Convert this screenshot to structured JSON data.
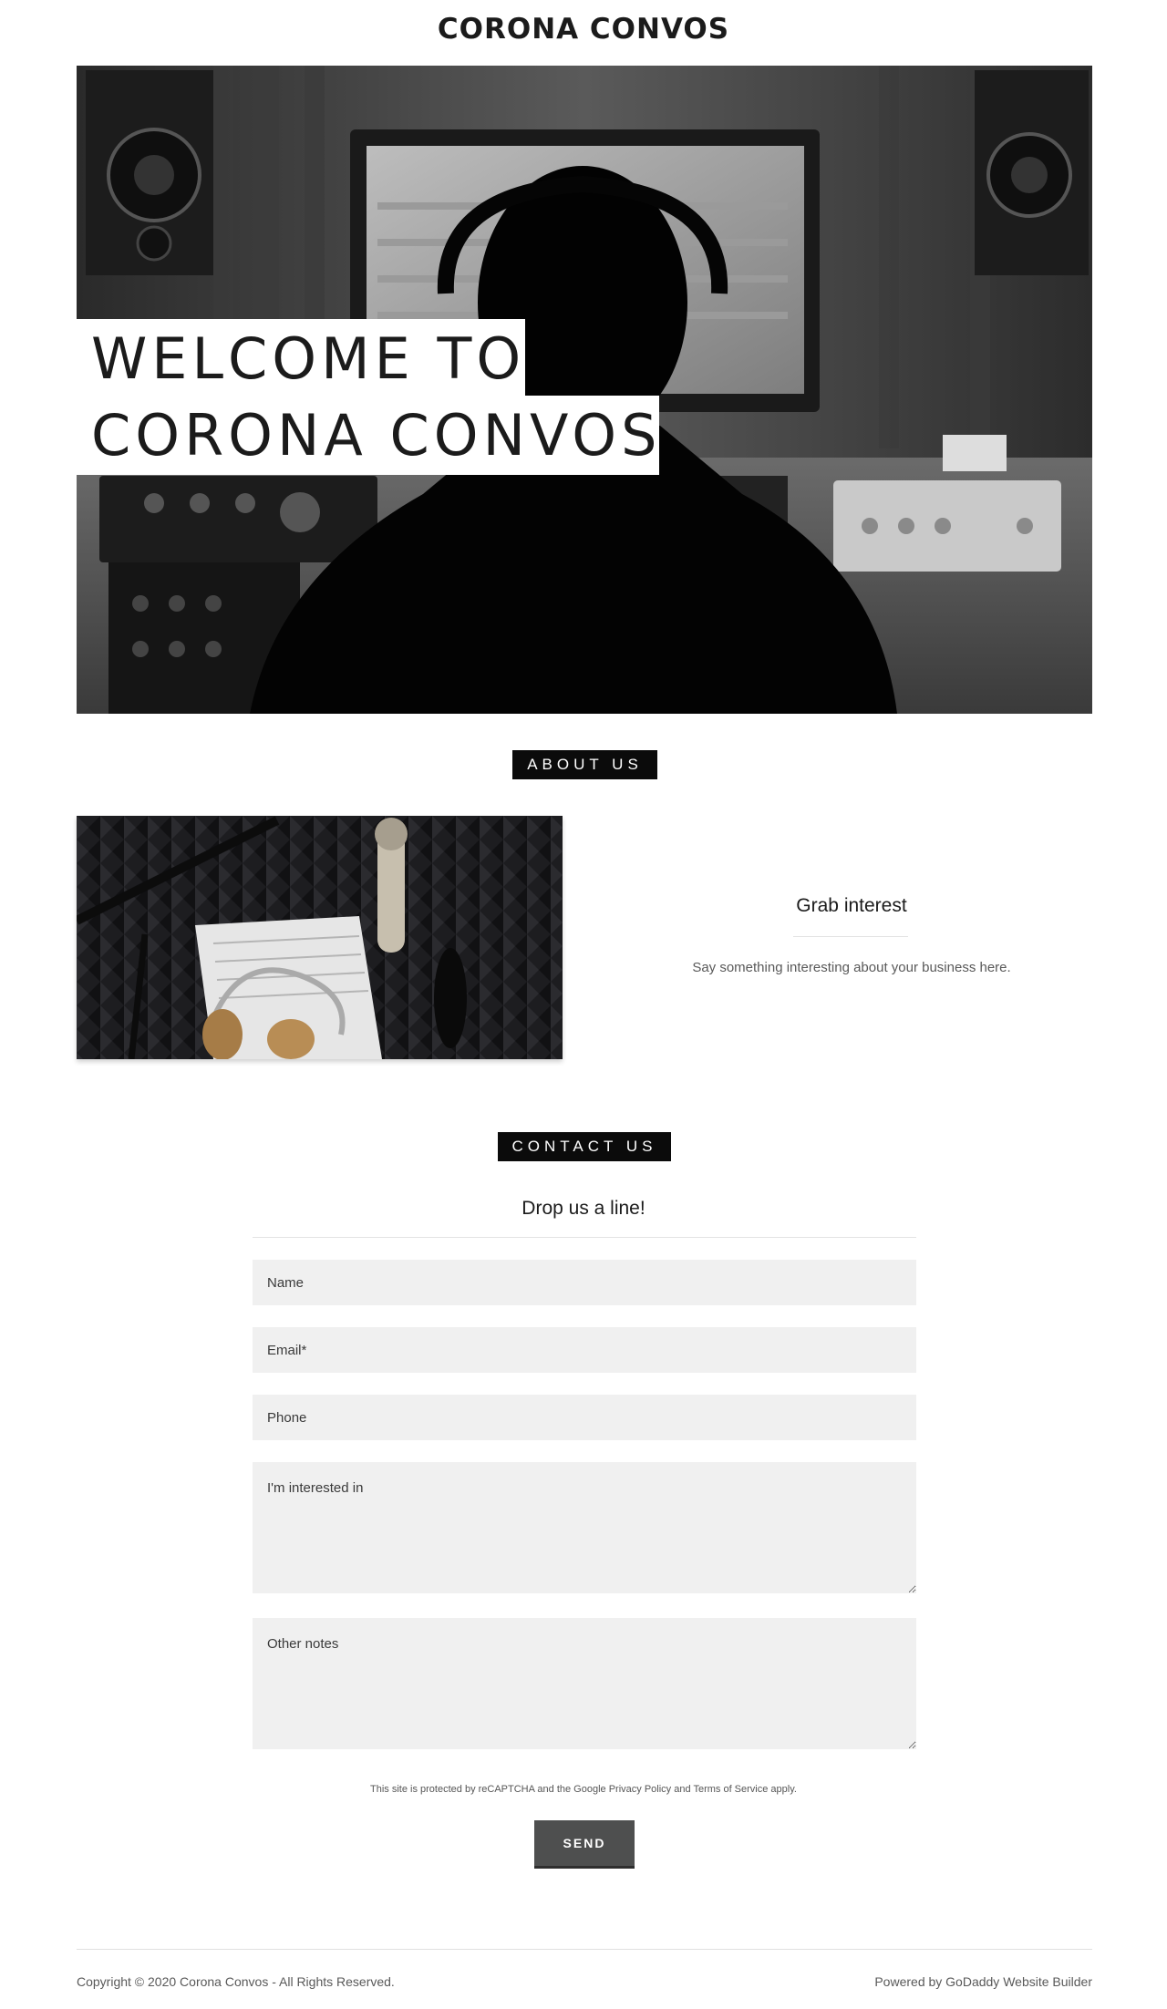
{
  "header": {
    "site_title": "CORONA CONVOS"
  },
  "hero": {
    "line1": "WELCOME TO",
    "line2": "CORONA CONVOS",
    "image": "studio-engineer-photo"
  },
  "about": {
    "section_label": "ABOUT US",
    "heading": "Grab interest",
    "text": "Say something interesting about your business here.",
    "image": "microphone-headphones-photo"
  },
  "contact": {
    "section_label": "CONTACT US",
    "heading": "Drop us a line!",
    "fields": {
      "name_placeholder": "Name",
      "email_placeholder": "Email*",
      "phone_placeholder": "Phone",
      "interest_placeholder": "I'm interested in",
      "notes_placeholder": "Other notes"
    },
    "recaptcha": {
      "prefix": "This site is protected by reCAPTCHA and the Google ",
      "privacy_link": "Privacy Policy",
      "middle": " and ",
      "terms_link": "Terms of Service",
      "suffix": " apply."
    },
    "send_label": "SEND"
  },
  "footer": {
    "copyright": "Copyright © 2020 Corona Convos - All Rights Reserved.",
    "powered_by": "Powered by GoDaddy Website Builder"
  },
  "colors": {
    "label_bg": "#0b0b0b",
    "field_bg": "#f0f0f0",
    "button_bg": "#4e4f4f",
    "muted_text": "#595959"
  }
}
